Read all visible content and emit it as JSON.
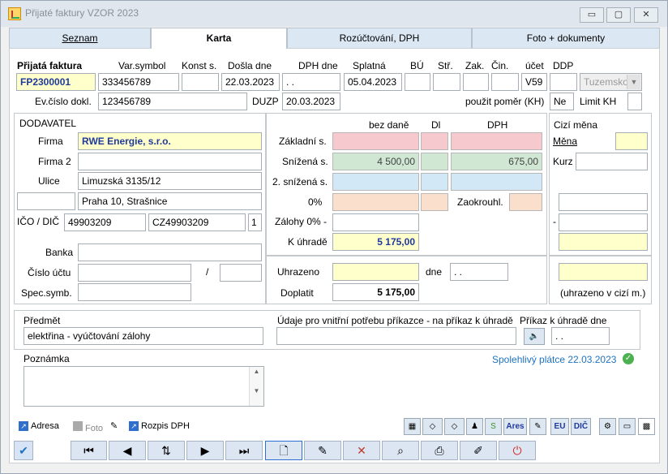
{
  "window": {
    "title": "Přijaté faktury VZOR 2023",
    "min": "▭",
    "max": "▢",
    "close": "✕"
  },
  "tabs": [
    "Seznam",
    "Karta",
    "Rozúčtování, DPH",
    "Foto + dokumenty"
  ],
  "header": {
    "labels": {
      "faktura": "Přijatá faktura",
      "varsym": "Var.symbol",
      "konst": "Konst s.",
      "dosla": "Došla dne",
      "dphdne": "DPH dne",
      "splatna": "Splatná",
      "bu": "BÚ",
      "str": "Stř.",
      "zak": "Zak.",
      "cin": "Čin.",
      "ucet": "účet",
      "ddp": "DDP",
      "evcislo": "Ev.číslo dokl.",
      "duzp": "DUZP",
      "pomer": "použit poměr (KH)",
      "limitkh": "Limit KH"
    },
    "values": {
      "faktura": "FP2300001",
      "varsym": "333456789",
      "dosla": "22.03.2023",
      "dphdne": ". .",
      "splatna": "05.04.2023",
      "ucet": "V59",
      "tuzemsko": "Tuzemsko",
      "evcislo": "123456789",
      "duzp": "20.03.2023",
      "pomer": "Ne"
    }
  },
  "supplier": {
    "labels": {
      "title": "DODAVATEL",
      "firma": "Firma",
      "firma2": "Firma 2",
      "ulice": "Ulice",
      "ico": "IČO / DIČ",
      "banka": "Banka",
      "ucet": "Číslo účtu",
      "slash": "/",
      "spec": "Spec.symb."
    },
    "values": {
      "firma": "RWE Energie, s.r.o.",
      "ulice": "Limuzská 3135/12",
      "mesto": "Praha 10, Strašnice",
      "ico": "49903209",
      "dic": "CZ49903209",
      "flag": "1"
    }
  },
  "amounts": {
    "labels": {
      "bezdane": "bez daně",
      "dl": "Dl",
      "dph": "DPH",
      "zakladni": "Základní s.",
      "snizena": "Snížená s.",
      "snizena2": "2. snížená s.",
      "nula": "0%",
      "zalohy": "Zálohy 0% -",
      "kuhrade": "K úhradě",
      "zaokrouhl": "Zaokrouhl.",
      "uhrazeno": "Uhrazeno",
      "dne": "dne",
      "doplatit": "Doplatit"
    },
    "values": {
      "snizena_zaklad": "4 500,00",
      "snizena_dph": "675,00",
      "kuhrade": "5 175,00",
      "dne": ". .",
      "doplatit": "5 175,00"
    }
  },
  "foreign": {
    "labels": {
      "title": "Cizí měna",
      "mena": "Měna",
      "kurz": "Kurz",
      "dash": "-",
      "uhrazeno": "(uhrazeno v cizí m.)"
    }
  },
  "bottom": {
    "labels": {
      "predmet": "Předmět",
      "udaje": "Údaje pro vnitřní potřebu příkazce - na příkaz k úhradě",
      "prikaz": "Příkaz k úhradě dne",
      "poznamka": "Poznámka"
    },
    "values": {
      "predmet": "elektřina - vyúčtování zálohy",
      "prikaz": ". .",
      "platce": "Spolehlivý plátce 22.03.2023"
    }
  },
  "links": {
    "adresa": "Adresa",
    "foto": "Foto",
    "rozpis": "Rozpis DPH"
  },
  "tools": {
    "ares": "Ares",
    "eu": "EU",
    "dic": "DIČ"
  }
}
